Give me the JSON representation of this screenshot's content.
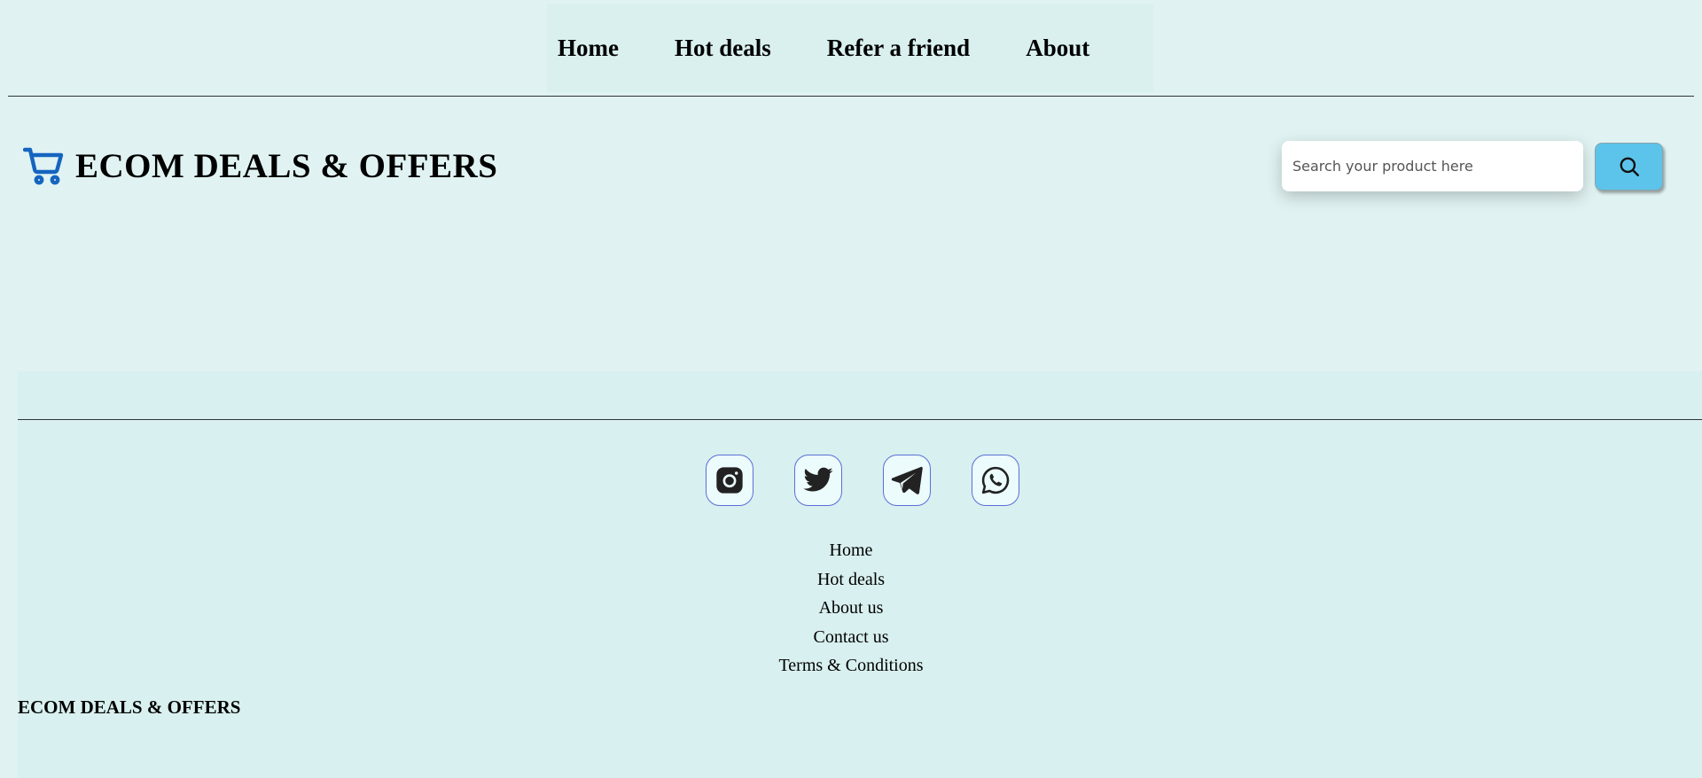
{
  "nav": {
    "items": [
      {
        "label": "Home"
      },
      {
        "label": "Hot deals"
      },
      {
        "label": "Refer a friend"
      },
      {
        "label": "About"
      }
    ]
  },
  "brand": {
    "title": "ECOM DEALS & OFFERS",
    "icon": "shopping-cart-icon"
  },
  "search": {
    "placeholder": "Search your product here",
    "value": "",
    "button_icon": "search-icon"
  },
  "footer": {
    "socials": [
      {
        "name": "instagram-icon"
      },
      {
        "name": "twitter-icon"
      },
      {
        "name": "telegram-icon"
      },
      {
        "name": "whatsapp-icon"
      }
    ],
    "links": [
      {
        "label": "Home"
      },
      {
        "label": "Hot deals"
      },
      {
        "label": "About us"
      },
      {
        "label": "Contact us"
      },
      {
        "label": "Terms & Conditions"
      }
    ],
    "brand": "ECOM DEALS & OFFERS"
  },
  "colors": {
    "background": "#e0f3f2",
    "footer_background": "#d8f0ef",
    "accent_blue": "#1565c0",
    "search_button": "#5cc4ea"
  }
}
